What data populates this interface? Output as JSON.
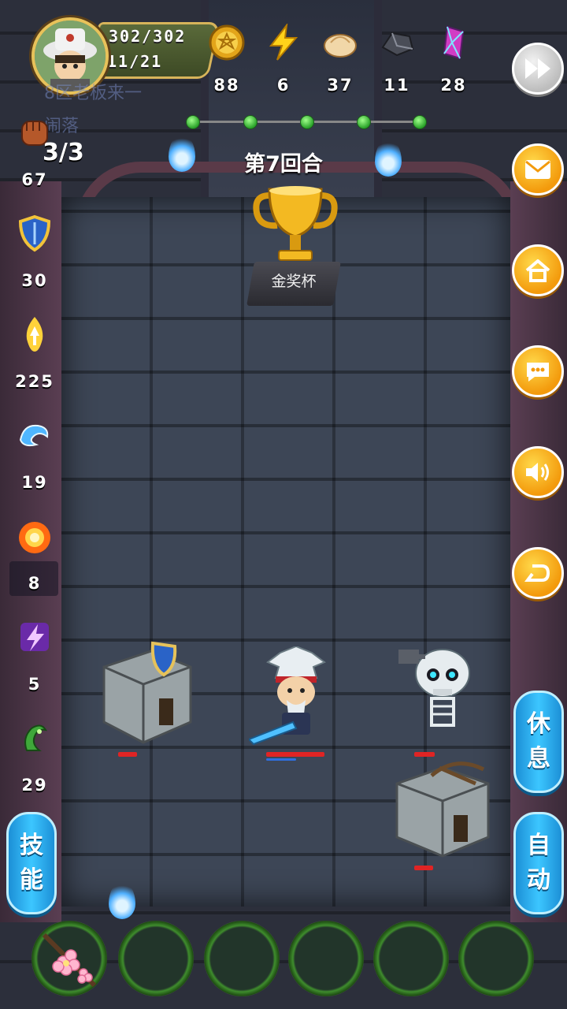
{
  "header": {
    "hp": "302/302",
    "level_progress": "11/21",
    "guild_line1": "8区老板来一",
    "guild_line2": "闹落"
  },
  "resources": [
    {
      "name": "gold-coin-icon",
      "value": "88"
    },
    {
      "name": "lightning-energy-icon",
      "value": "6"
    },
    {
      "name": "bun-food-icon",
      "value": "37"
    },
    {
      "name": "iron-ore-icon",
      "value": "11"
    },
    {
      "name": "crystal-gem-icon",
      "value": "28"
    }
  ],
  "round": {
    "label": "第7回合"
  },
  "trophy": {
    "label": "金奖杯"
  },
  "wave": {
    "value": "3/3"
  },
  "stats": [
    {
      "name": "attack-fist-icon",
      "value": "67"
    },
    {
      "name": "shield-defense-icon",
      "value": "30"
    },
    {
      "name": "holy-light-icon",
      "value": "225"
    },
    {
      "name": "water-wave-icon",
      "value": "19"
    },
    {
      "name": "fire-burst-icon",
      "value": "8"
    },
    {
      "name": "lightning-purple-icon",
      "value": "5"
    },
    {
      "name": "poison-green-icon",
      "value": "29"
    }
  ],
  "buttons": {
    "rest_chars": [
      "休",
      "息"
    ],
    "auto_chars": [
      "自",
      "动"
    ],
    "skill_chars": [
      "技",
      "能"
    ]
  },
  "colors": {
    "accent_orange": "#f39a0c",
    "pill_blue": "#2fb4f0",
    "hp_red": "#e02424",
    "mp_blue": "#2e6fe0"
  }
}
